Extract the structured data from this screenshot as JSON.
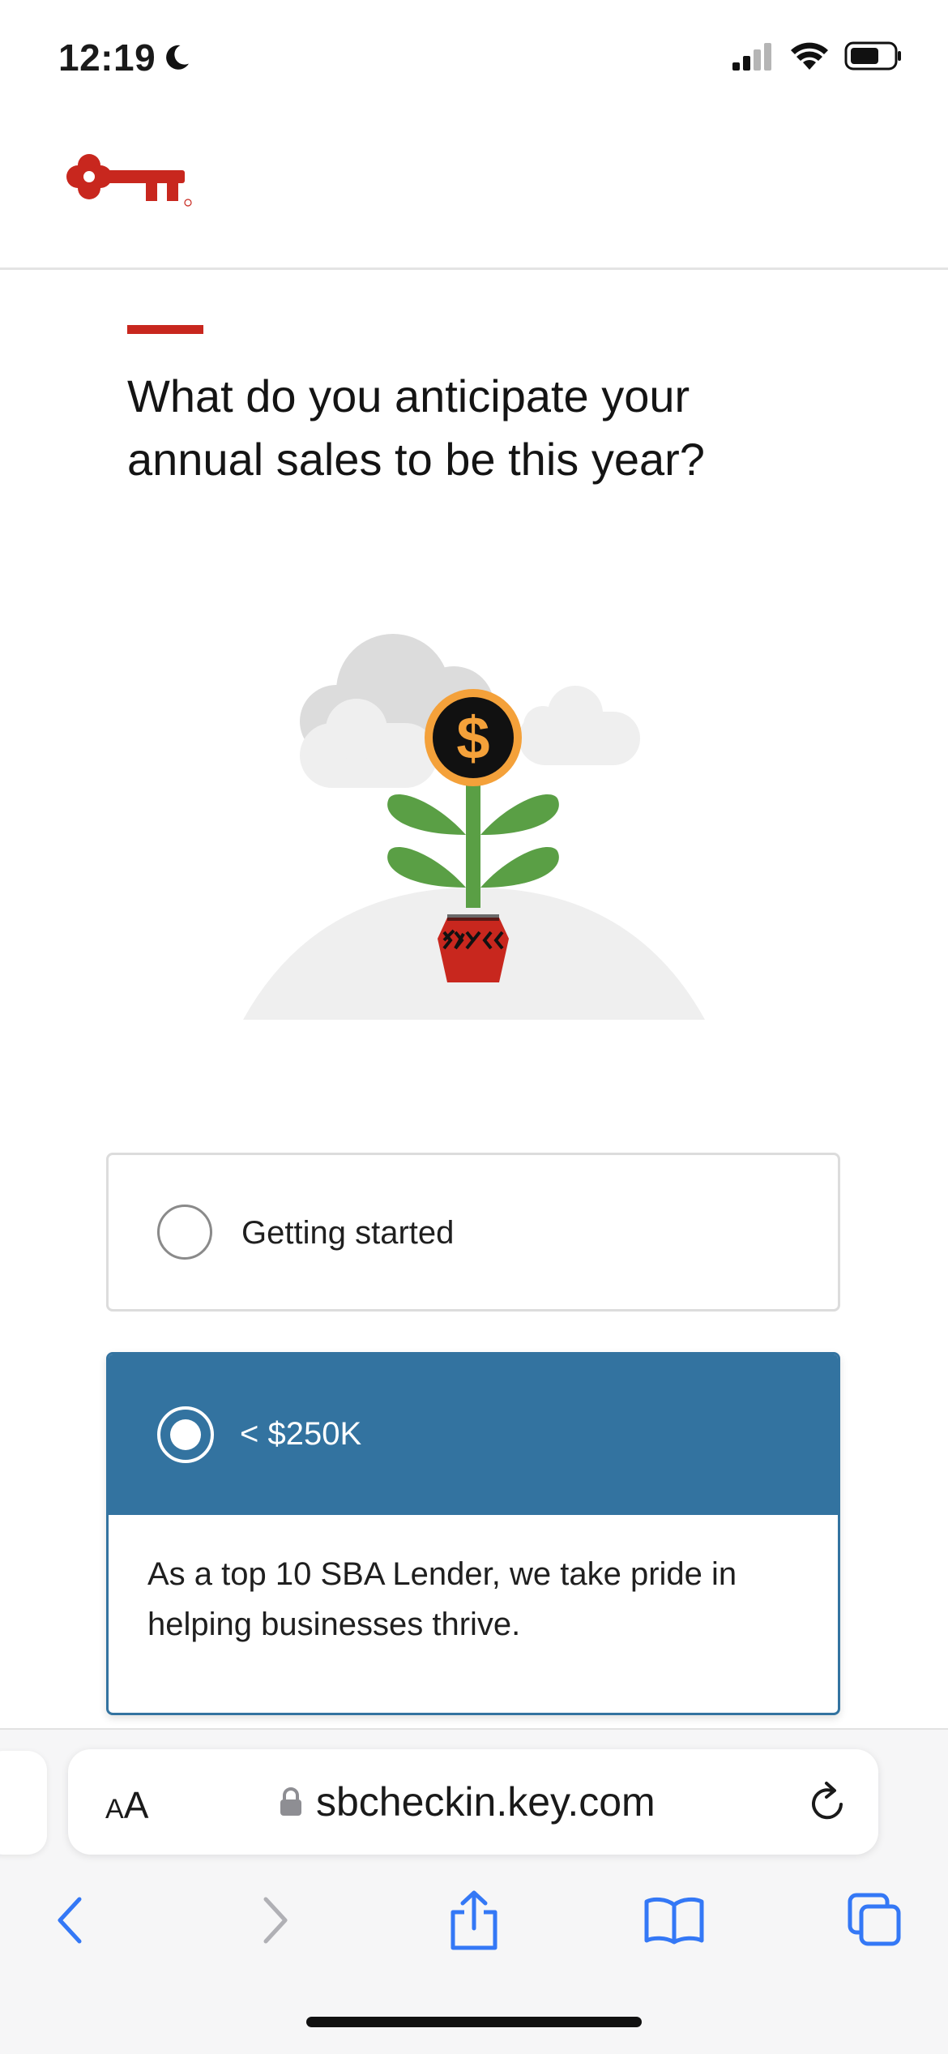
{
  "status_bar": {
    "time": "12:19"
  },
  "brand": {
    "accent_color": "#c8271e",
    "logo_icon": "key-logo"
  },
  "question": {
    "text": "What do you anticipate your annual sales to be this year?"
  },
  "illustration": {
    "name": "money-plant-illustration"
  },
  "options": [
    {
      "label": "Getting started",
      "selected": false
    },
    {
      "label": "< $250K",
      "selected": true,
      "description": "As a top 10 SBA Lender, we take pride in helping businesses thrive."
    }
  ],
  "browser": {
    "text_size_label_small": "A",
    "text_size_label_large": "A",
    "url": "sbcheckin.key.com",
    "accent_color": "#3478f6"
  },
  "colors": {
    "selected_option": "#3373a0"
  }
}
